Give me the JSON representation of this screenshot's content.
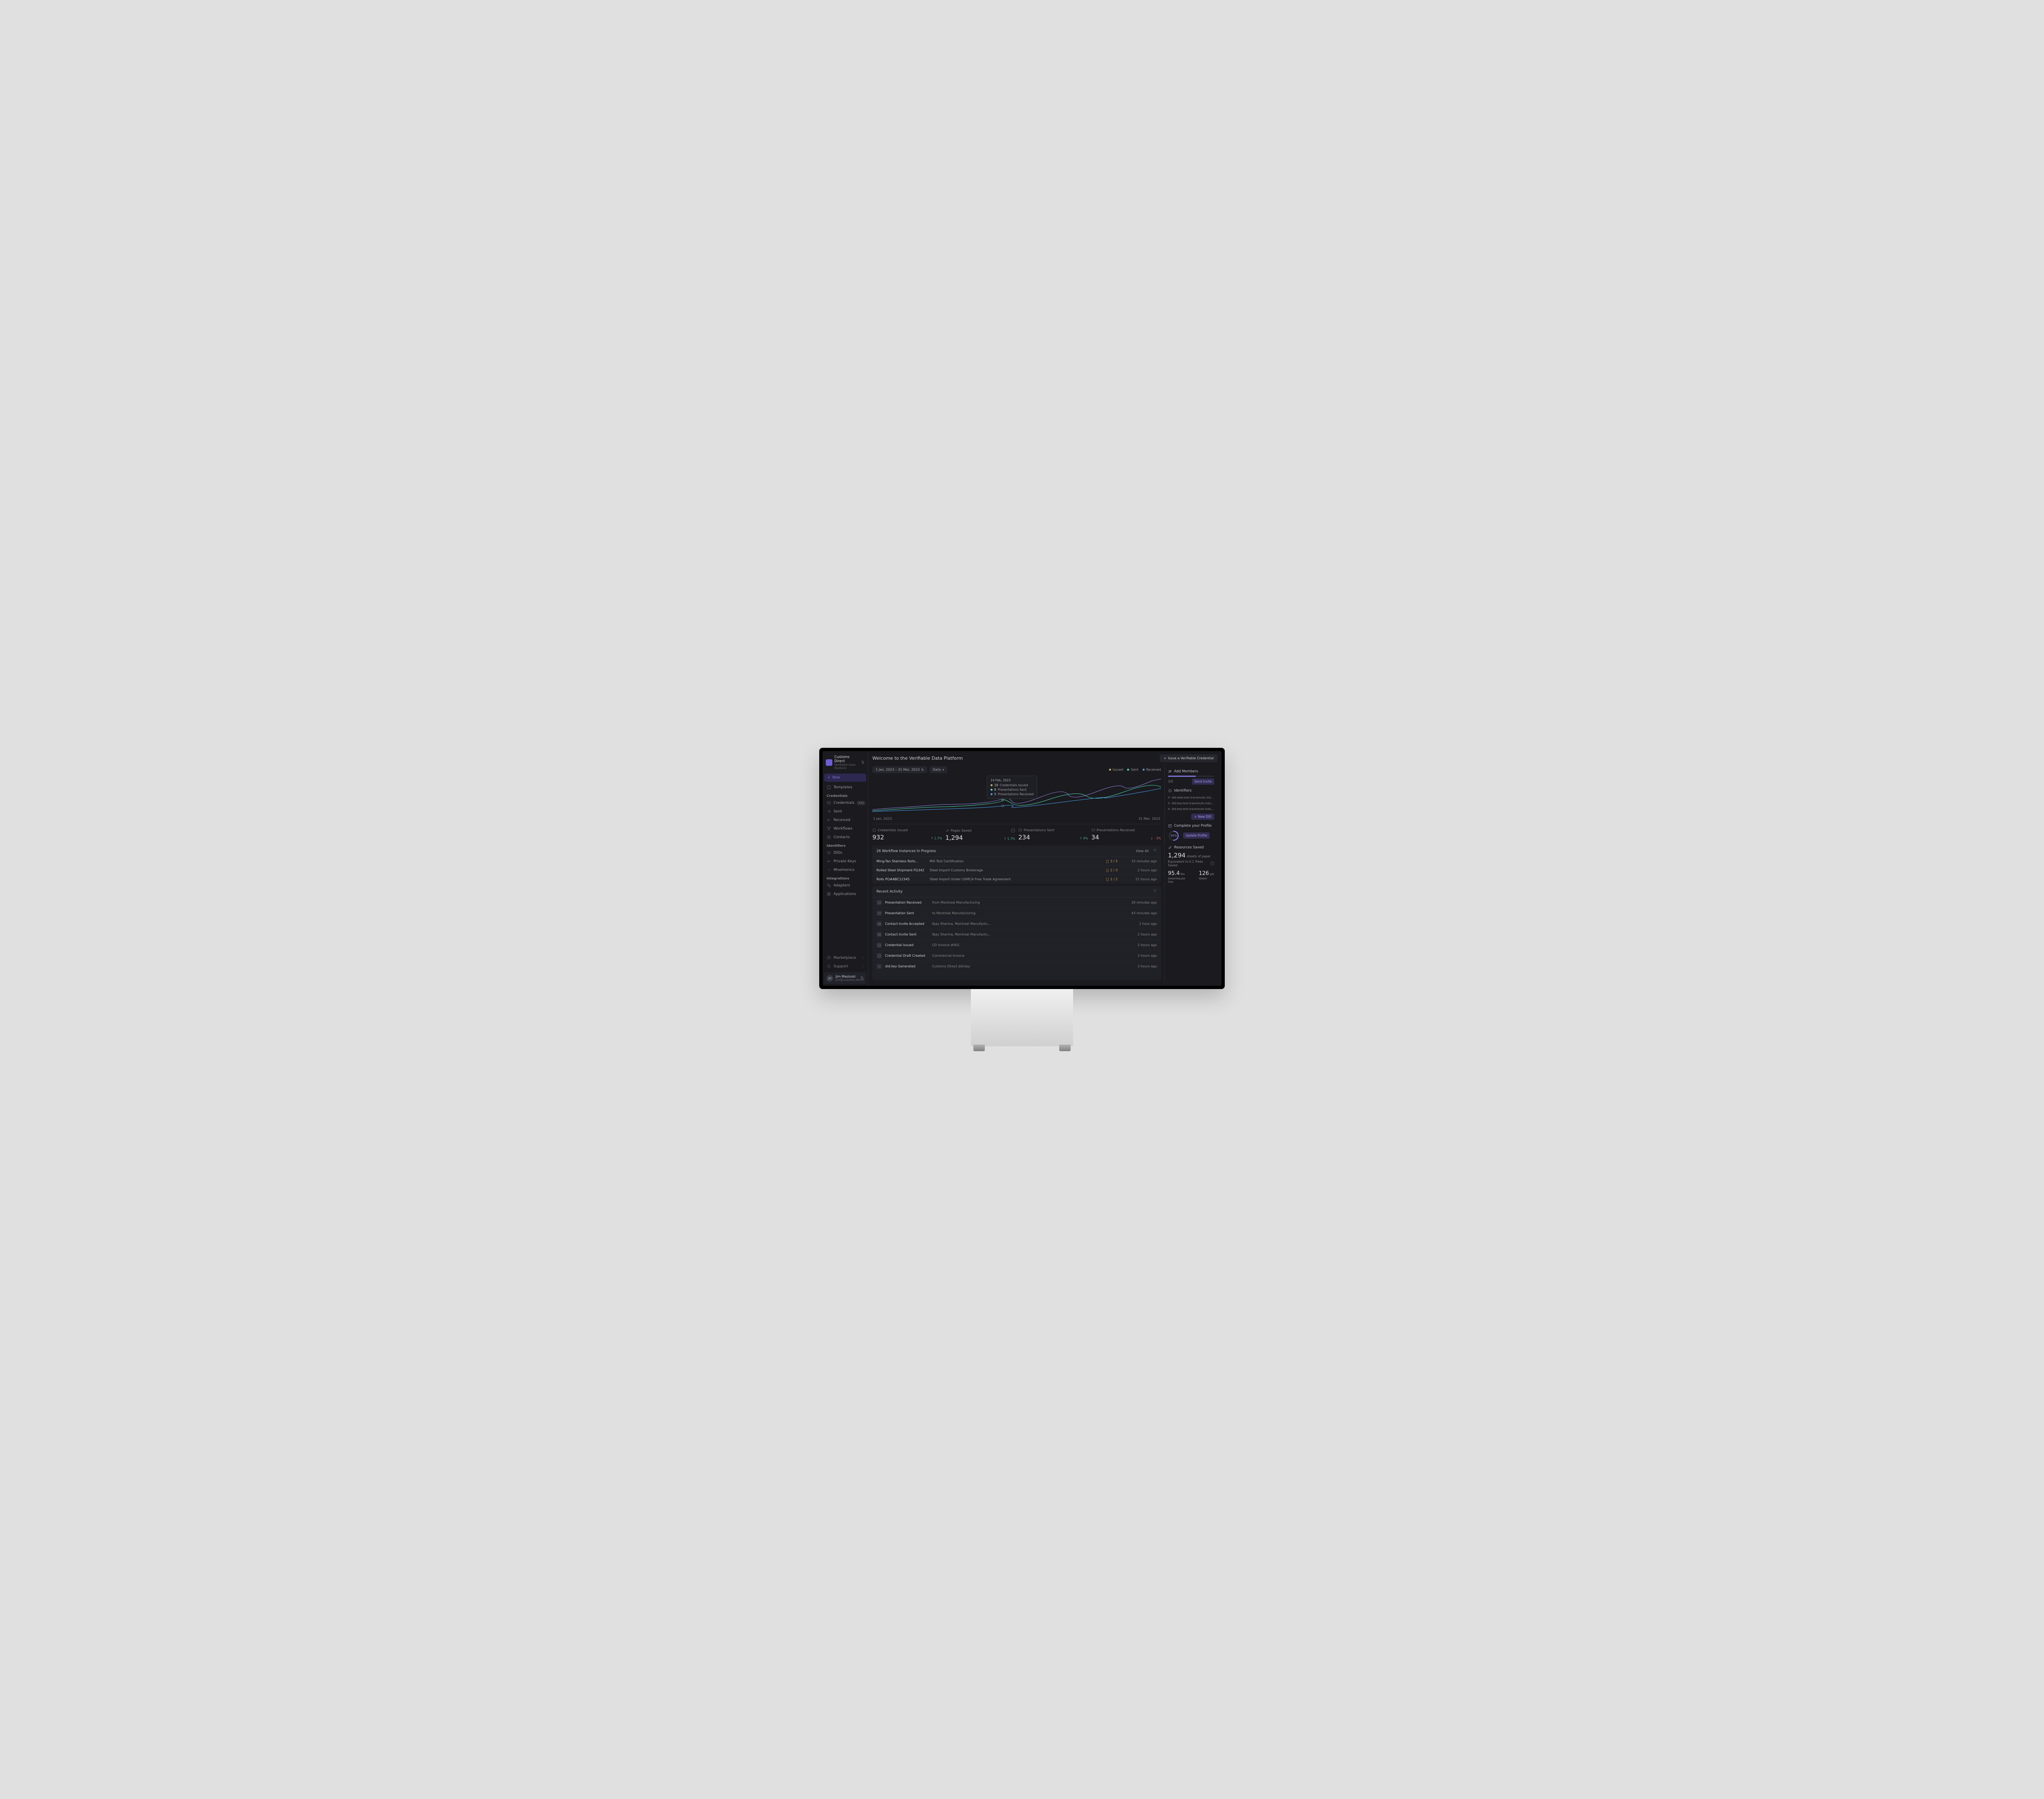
{
  "org": {
    "name": "Customs Direct",
    "sub": "Verifiable Data Platform"
  },
  "newBtn": "New",
  "nav": {
    "templates": "Templates",
    "credH": "Credentials",
    "creds": "Credentials",
    "credsBadge": "432",
    "sent": "Sent",
    "received": "Received",
    "workflows": "Workflows",
    "contacts": "Contacts",
    "idH": "Identifiers",
    "dids": "DIDs",
    "pk": "Private Keys",
    "mne": "Mnemonics",
    "intH": "Integrations",
    "adapters": "Adapters",
    "apps": "Applications",
    "market": "Marketplace",
    "support": "Support"
  },
  "user": {
    "name": "Jim Masloski",
    "email": "jim@customs.direct",
    "init": "JM"
  },
  "title": "Welcome to the Verifiable Data Platform",
  "issueBtn": "Issue a Verifiable Credential",
  "dateRange": "1 Jan, 2023 – 31 Mar, 2023",
  "gran": "Daily",
  "legend": {
    "issued": "Issued",
    "sent": "Sent",
    "received": "Received"
  },
  "tooltip": {
    "date": "14 Feb, 2023",
    "issuedN": "19",
    "issuedL": "Credentials Issued",
    "sentN": "8",
    "sentL": "Presentations Sent",
    "recvN": "5",
    "recvL": "Presentations Received"
  },
  "chartDates": {
    "start": "1 Jan, 2023",
    "end": "31 Mar, 2023"
  },
  "stats": {
    "s0": {
      "l": "Credentials Issued",
      "v": "932",
      "d": "↑ 1.7%"
    },
    "s1": {
      "l": "Pages Saved",
      "v": "1,294",
      "d": "↑ 1.7%"
    },
    "s2": {
      "l": "Presentations Sent",
      "v": "234",
      "d": "↑ 4%"
    },
    "s3": {
      "l": "Presentations Received",
      "v": "34",
      "d": "↓ · 3%"
    }
  },
  "wf": {
    "title": "26 Workflow Instances In Progress",
    "viewAll": "View All",
    "r0": {
      "a": "Ming-Tan Stainless Rolls…",
      "b": "Mill Test Certification",
      "c": "3 / 5",
      "d": "33 minutes ago"
    },
    "r1": {
      "a": "Rolled Steel Shipment FG342",
      "b": "Steel Import Customs Brokerage",
      "c": "2 / 3",
      "d": "2 hours ago"
    },
    "r2": {
      "a": "Rolls PO#ABC12345",
      "b": "Steel Import Under USMCA Free Trade Agreement",
      "c": "1 / 2",
      "d": "21 hours ago"
    }
  },
  "activity": {
    "title": "Recent Activity",
    "r0": {
      "t": "Presentation Received",
      "d": "from Montreal Manufacturing",
      "tm": "28 minutes ago"
    },
    "r1": {
      "t": "Presentation Sent",
      "d": "to Montreal Manufacturing",
      "tm": "43 minutes ago"
    },
    "r2": {
      "t": "Contact Invite Accepted",
      "d": "Ajay Sharma, Montreal Manufactu…",
      "tm": "1 hour ago"
    },
    "r3": {
      "t": "Contact Invite Sent",
      "d": "Ajay Sharma, Montreal Manufactu…",
      "tm": "2 hours ago"
    },
    "r4": {
      "t": "Credential Issued",
      "d": "CD Invoice #001",
      "tm": "2 hours ago"
    },
    "r5": {
      "t": "Credential Draft Created",
      "d": "Commercial Invoice",
      "tm": "2 hours ago"
    },
    "r6": {
      "t": "did:key Generated",
      "d": "Customs Direct did:key",
      "tm": "3 hours ago"
    }
  },
  "members": {
    "title": "Add Members",
    "frac": "3/5",
    "btn": "Send Invite"
  },
  "ident": {
    "title": "Identifiers",
    "d0": "did:web:text.transmute.indu…Y7gjau",
    "d1": "did:key:test.transmute.indu…bHasGs",
    "d2": "did:key:test.transmute.indu…hxj75A",
    "btn": "New DID"
  },
  "profile": {
    "title": "Complete your Profile",
    "pct": "50%",
    "btn": "Update Profile"
  },
  "res": {
    "title": "Resources Saved",
    "paperN": "1,294",
    "paperU": "sheets of paper",
    "treeSub": "Equivalent to 0.1 Trees Saved",
    "gasN": "95.4",
    "gasU": "lbs",
    "gasL": "Greenhouse Gas",
    "watN": "126",
    "watU": "gal",
    "watL": "Water"
  },
  "chart_data": {
    "type": "line",
    "x_start": "2023-01-01",
    "x_end": "2023-03-31",
    "tooltip_date": "2023-02-14",
    "series": [
      {
        "name": "Issued",
        "color": "#8b7fd6",
        "values": [
          7,
          8,
          7,
          9,
          8,
          7,
          8,
          9,
          10,
          9,
          10,
          11,
          10,
          12,
          11,
          13,
          12,
          11,
          13,
          12,
          14,
          13,
          15,
          14,
          16,
          15,
          17,
          16,
          18,
          17,
          19,
          18,
          17,
          18,
          17,
          18,
          19,
          18,
          20,
          19,
          20,
          21,
          20,
          22,
          21,
          23,
          22,
          24,
          23,
          25,
          24,
          26,
          25,
          27,
          26,
          28,
          27,
          29,
          28,
          30,
          29,
          28,
          29,
          31,
          30,
          32,
          31,
          33,
          32,
          34,
          33,
          35,
          34,
          36,
          35,
          37,
          36,
          38,
          37,
          38,
          37,
          39,
          38,
          40,
          41,
          40,
          42,
          41,
          43
        ]
      },
      {
        "name": "Sent",
        "color": "#4fd5a8",
        "values": [
          5,
          6,
          5,
          7,
          6,
          5,
          6,
          7,
          6,
          7,
          8,
          7,
          9,
          8,
          10,
          9,
          11,
          10,
          12,
          11,
          13,
          12,
          11,
          12,
          13,
          12,
          14,
          13,
          12,
          13,
          12,
          13,
          14,
          13,
          15,
          14,
          13,
          14,
          13,
          14,
          15,
          14,
          16,
          15,
          14,
          15,
          16,
          15,
          17,
          16,
          18,
          17,
          19,
          18,
          20,
          19,
          21,
          20,
          22,
          21,
          20,
          21,
          22,
          21,
          23,
          22,
          24,
          23,
          24,
          23,
          24,
          23,
          25,
          24,
          25,
          24,
          26,
          25,
          26,
          25,
          26,
          25,
          27,
          26,
          28,
          27,
          28,
          29,
          28
        ]
      },
      {
        "name": "Received",
        "color": "#4a9de8",
        "values": [
          3,
          4,
          3,
          4,
          5,
          4,
          5,
          4,
          5,
          6,
          5,
          6,
          5,
          6,
          7,
          6,
          7,
          6,
          7,
          8,
          7,
          8,
          7,
          8,
          9,
          8,
          9,
          8,
          9,
          10,
          9,
          10,
          9,
          10,
          11,
          10,
          11,
          10,
          11,
          12,
          11,
          12,
          11,
          12,
          13,
          12,
          13,
          12,
          13,
          14,
          13,
          14,
          13,
          14,
          15,
          14,
          15,
          14,
          15,
          16,
          15,
          16,
          17,
          16,
          17,
          16,
          17,
          18,
          17,
          18,
          19,
          18,
          19,
          18,
          19,
          20,
          19,
          20,
          21,
          20,
          21,
          22,
          21,
          22,
          21,
          23,
          22,
          23,
          27
        ]
      }
    ]
  }
}
